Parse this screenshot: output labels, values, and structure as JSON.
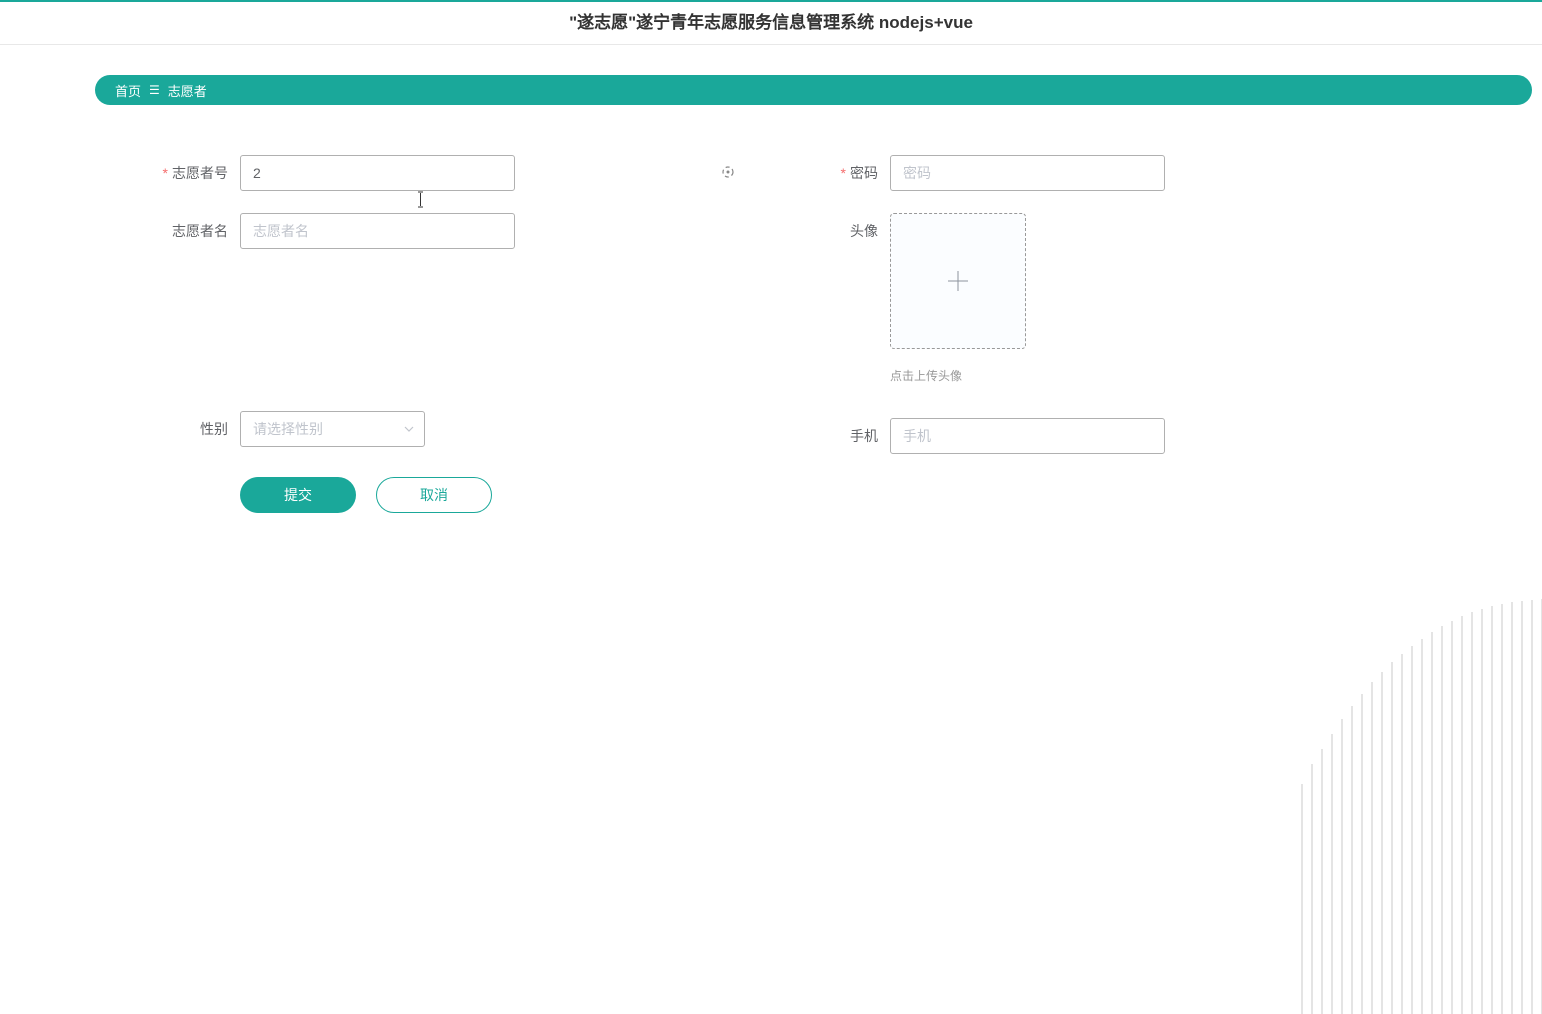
{
  "header": {
    "title": "\"遂志愿\"遂宁青年志愿服务信息管理系统 nodejs+vue"
  },
  "breadcrumb": {
    "home": "首页",
    "current": "志愿者"
  },
  "form": {
    "volunteer_id": {
      "label": "志愿者号",
      "value": "2"
    },
    "password": {
      "label": "密码",
      "placeholder": "密码"
    },
    "volunteer_name": {
      "label": "志愿者名",
      "placeholder": "志愿者名"
    },
    "avatar": {
      "label": "头像",
      "hint": "点击上传头像"
    },
    "gender": {
      "label": "性别",
      "placeholder": "请选择性别"
    },
    "phone": {
      "label": "手机",
      "placeholder": "手机"
    }
  },
  "buttons": {
    "submit": "提交",
    "cancel": "取消"
  }
}
